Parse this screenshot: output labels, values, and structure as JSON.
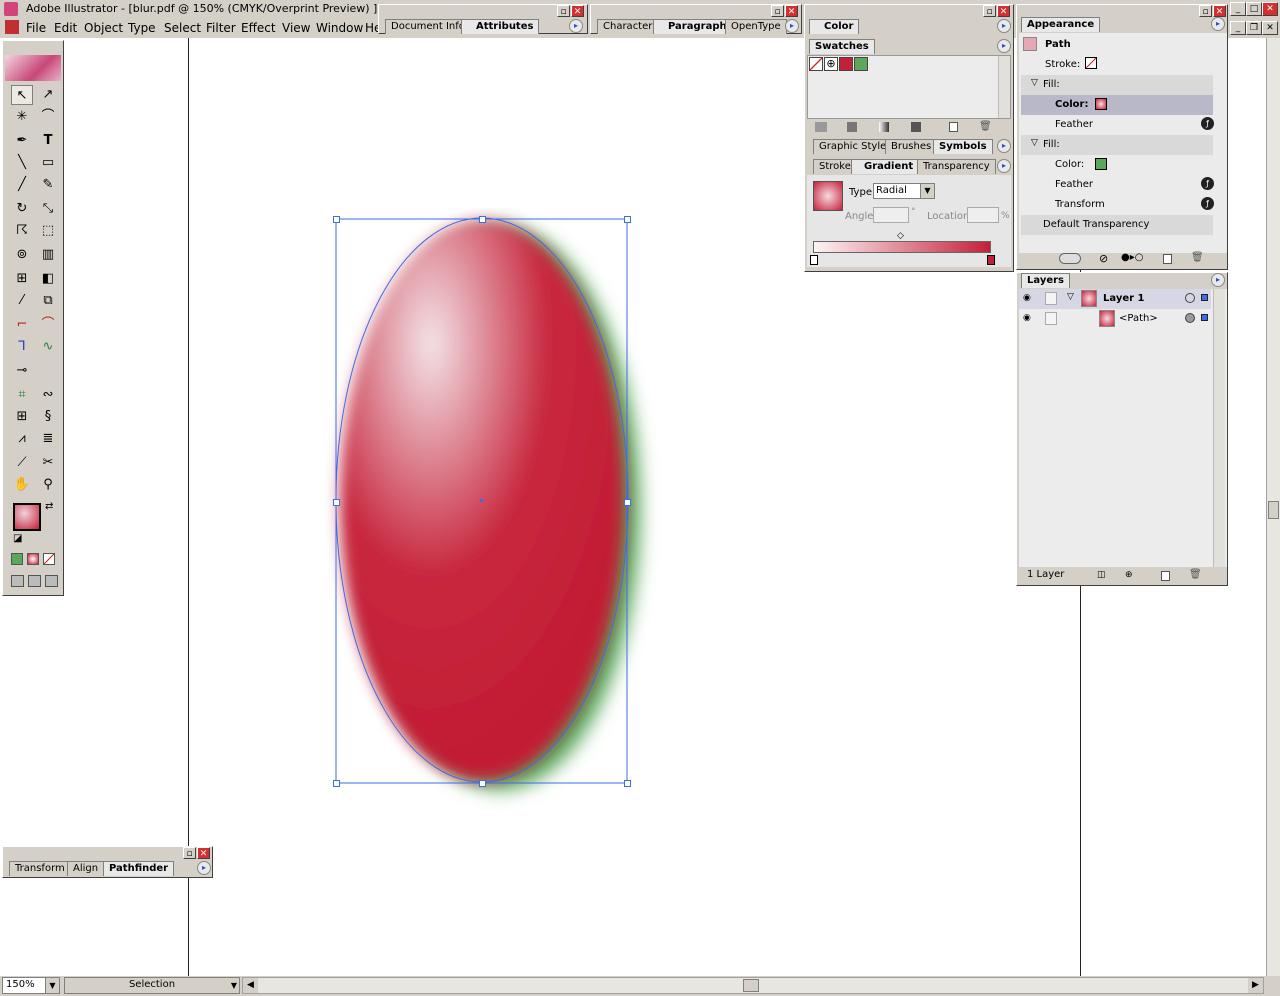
{
  "window": {
    "title": "Adobe Illustrator - [blur.pdf @ 150% (CMYK/Overprint Preview) ]"
  },
  "menu": [
    "File",
    "Edit",
    "Object",
    "Type",
    "Select",
    "Filter",
    "Effect",
    "View",
    "Window",
    "He"
  ],
  "panels": {
    "docinfo": {
      "tabs": [
        "Document Info",
        "Attributes"
      ]
    },
    "character": {
      "tabs": [
        "Character",
        "Paragraph",
        "OpenType"
      ]
    },
    "color": {
      "tab": "Color"
    },
    "swatches": {
      "tab": "Swatches"
    },
    "styles": {
      "tabs": [
        "Graphic Styles",
        "Brushes",
        "Symbols"
      ]
    },
    "gradient": {
      "tabs": [
        "Stroke",
        "Gradient",
        "Transparency"
      ],
      "type_label": "Type:",
      "type_value": "Radial",
      "angle_label": "Angle:",
      "location_label": "Location:",
      "angle_unit": "°",
      "location_unit": "%"
    },
    "appearance": {
      "tab": "Appearance",
      "object": "Path",
      "rows": [
        "Stroke:",
        "Fill:",
        "Color:",
        "Feather",
        "Fill:",
        "Color:",
        "Feather",
        "Transform",
        "Default Transparency"
      ]
    },
    "layers": {
      "tab": "Layers",
      "layer_name": "Layer 1",
      "path_name": "<Path>",
      "footer": "1 Layer"
    },
    "pathfinder": {
      "tabs": [
        "Transform",
        "Align",
        "Pathfinder"
      ]
    }
  },
  "status": {
    "zoom": "150%",
    "mode": "Selection"
  },
  "colors": {
    "accent": "#c4203a",
    "selection": "#3a6ee8",
    "green": "#5aa85a"
  }
}
